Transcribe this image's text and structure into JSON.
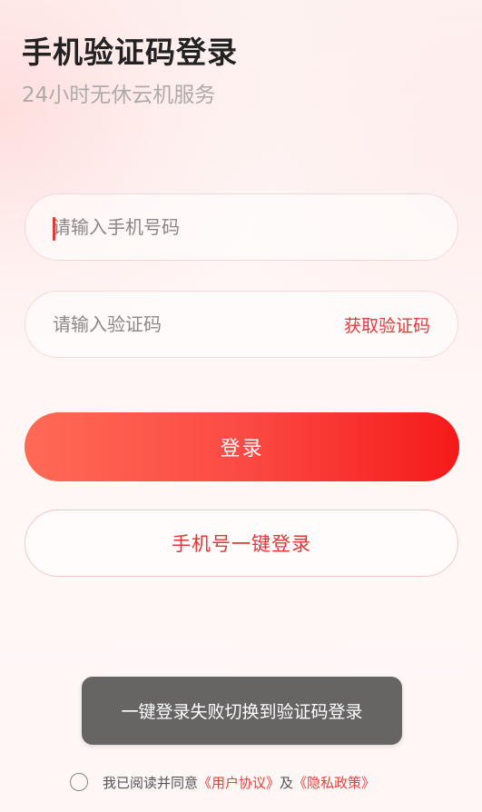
{
  "header": {
    "title": "手机验证码登录",
    "subtitle": "24小时无休云机服务"
  },
  "form": {
    "phone_placeholder": "请输入手机号码",
    "code_placeholder": "请输入验证码",
    "get_code_label": "获取验证码",
    "login_label": "登录",
    "onekey_login_label": "手机号一键登录"
  },
  "toast": {
    "message": "一键登录失败切换到验证码登录"
  },
  "agreement": {
    "prefix": "我已阅读并同意",
    "user_agreement": "《用户协议》",
    "and": "及",
    "privacy_policy": "《隐私政策》",
    "checked": false
  },
  "colors": {
    "accent": "#f23b37",
    "toast_bg": "#676464"
  }
}
